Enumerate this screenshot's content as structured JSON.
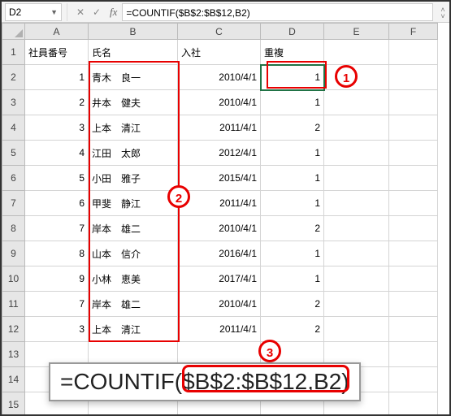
{
  "namebox": {
    "value": "D2"
  },
  "formula_bar": {
    "value": "=COUNTIF($B$2:$B$12,B2)"
  },
  "columns": [
    "A",
    "B",
    "C",
    "D",
    "E",
    "F"
  ],
  "rowCount": 15,
  "headers": {
    "A": "社員番号",
    "B": "氏名",
    "C": "入社",
    "D": "重複"
  },
  "rows": [
    {
      "A": "1",
      "B": "青木　良一",
      "C": "2010/4/1",
      "D": "1"
    },
    {
      "A": "2",
      "B": "井本　健夫",
      "C": "2010/4/1",
      "D": "1"
    },
    {
      "A": "3",
      "B": "上本　清江",
      "C": "2011/4/1",
      "D": "2"
    },
    {
      "A": "4",
      "B": "江田　太郎",
      "C": "2012/4/1",
      "D": "1"
    },
    {
      "A": "5",
      "B": "小田　雅子",
      "C": "2015/4/1",
      "D": "1"
    },
    {
      "A": "6",
      "B": "甲斐　静江",
      "C": "2011/4/1",
      "D": "1"
    },
    {
      "A": "7",
      "B": "岸本　雄二",
      "C": "2010/4/1",
      "D": "2"
    },
    {
      "A": "8",
      "B": "山本　信介",
      "C": "2016/4/1",
      "D": "1"
    },
    {
      "A": "9",
      "B": "小林　恵美",
      "C": "2017/4/1",
      "D": "1"
    },
    {
      "A": "7",
      "B": "岸本　雄二",
      "C": "2010/4/1",
      "D": "2"
    },
    {
      "A": "3",
      "B": "上本　清江",
      "C": "2011/4/1",
      "D": "2"
    }
  ],
  "annotations": {
    "circle1": "1",
    "circle2": "2",
    "circle3": "3"
  },
  "overlay_formula": "=COUNTIF($B$2:$B$12,B2)",
  "chart_data": {
    "type": "table",
    "title": "",
    "columns": [
      "社員番号",
      "氏名",
      "入社",
      "重複"
    ],
    "rows": [
      [
        1,
        "青木　良一",
        "2010/4/1",
        1
      ],
      [
        2,
        "井本　健夫",
        "2010/4/1",
        1
      ],
      [
        3,
        "上本　清江",
        "2011/4/1",
        2
      ],
      [
        4,
        "江田　太郎",
        "2012/4/1",
        1
      ],
      [
        5,
        "小田　雅子",
        "2015/4/1",
        1
      ],
      [
        6,
        "甲斐　静江",
        "2011/4/1",
        1
      ],
      [
        7,
        "岸本　雄二",
        "2010/4/1",
        2
      ],
      [
        8,
        "山本　信介",
        "2016/4/1",
        1
      ],
      [
        9,
        "小林　恵美",
        "2017/4/1",
        1
      ],
      [
        7,
        "岸本　雄二",
        "2010/4/1",
        2
      ],
      [
        3,
        "上本　清江",
        "2011/4/1",
        2
      ]
    ]
  }
}
